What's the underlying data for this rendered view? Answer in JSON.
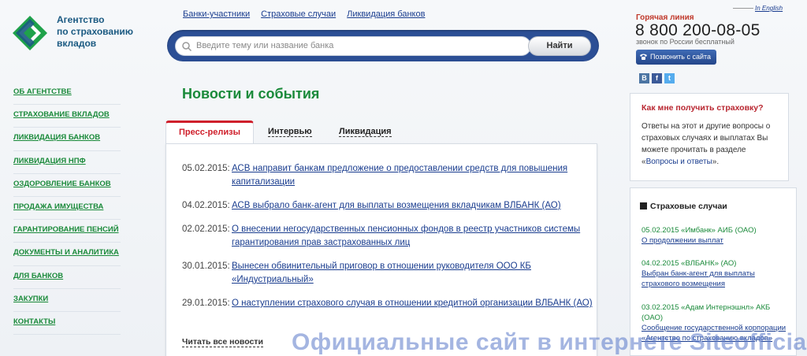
{
  "logo": {
    "line1": "Агентство",
    "line2": "по страхованию",
    "line3": "вкладов"
  },
  "toplinks": [
    "Банки-участники",
    "Страховые случаи",
    "Ликвидация банков"
  ],
  "search": {
    "placeholder": "Введите тему или название банка",
    "button": "Найти"
  },
  "lang": "In English",
  "hotline": {
    "label": "Горячая линия",
    "number": "8 800 200-08-05",
    "note": "звонок по России бесплатный",
    "call_button": "Позвонить с сайта"
  },
  "social": [
    "В",
    "f",
    "t"
  ],
  "nav": [
    "ОБ АГЕНТСТВЕ",
    "СТРАХОВАНИЕ ВКЛАДОВ",
    "ЛИКВИДАЦИЯ БАНКОВ",
    "ЛИКВИДАЦИЯ НПФ",
    "ОЗДОРОВЛЕНИЕ БАНКОВ",
    "ПРОДАЖА ИМУЩЕСТВА",
    "ГАРАНТИРОВАНИЕ ПЕНСИЙ",
    "ДОКУМЕНТЫ И АНАЛИТИКА",
    "ДЛЯ БАНКОВ",
    "ЗАКУПКИ",
    "КОНТАКТЫ"
  ],
  "main": {
    "title": "Новости и события",
    "tabs": [
      "Пресс-релизы",
      "Интервью",
      "Ликвидация банков"
    ],
    "news": [
      {
        "date": "05.02.2015:",
        "text": "АСВ направит банкам предложение о предоставлении средств для повышения капитализации"
      },
      {
        "date": "04.02.2015:",
        "text": "АСВ выбрало банк-агент для выплаты возмещения вкладчикам ВЛБАНК (АО)"
      },
      {
        "date": "02.02.2015:",
        "text": "О внесении негосударственных пенсионных фондов в реестр участников системы гарантирования прав застрахованных лиц"
      },
      {
        "date": "30.01.2015:",
        "text": "Вынесен обвинительный приговор в отношении руководителя ООО КБ «Индустриальный»"
      },
      {
        "date": "29.01.2015:",
        "text": "О наступлении страхового случая в отношении кредитной организации ВЛБАНК (АО)"
      }
    ],
    "read_all": "Читать все новости"
  },
  "faq": {
    "title": "Как мне получить страховку?",
    "text": "Ответы на этот и другие вопросы о страховых случаях и выплатах Вы можете прочитать в разделе «",
    "link": "Вопросы и ответы",
    "tail": "»."
  },
  "cases": {
    "title": "Страховые случаи",
    "items": [
      {
        "head": "05.02.2015 «Имбанк» АИБ (ОАО)",
        "link": "О продолжении выплат"
      },
      {
        "head": "04.02.2015 «ВЛБАНК» (АО)",
        "link": "Выбран банк-агент для выплаты страхового возмещения"
      },
      {
        "head": "03.02.2015 «Адам Интернэшнл» АКБ (ОАО)",
        "link": "Сообщение государственной корпорации «Агентство по страхованию вкладов»"
      }
    ]
  },
  "watermark": "Официальные сайт в интернете Siteofficial.ru",
  "colors": {
    "green": "#1a8a3a",
    "red": "#cf1f2b",
    "blue": "#2c4f95",
    "link": "#1a3d8f"
  }
}
